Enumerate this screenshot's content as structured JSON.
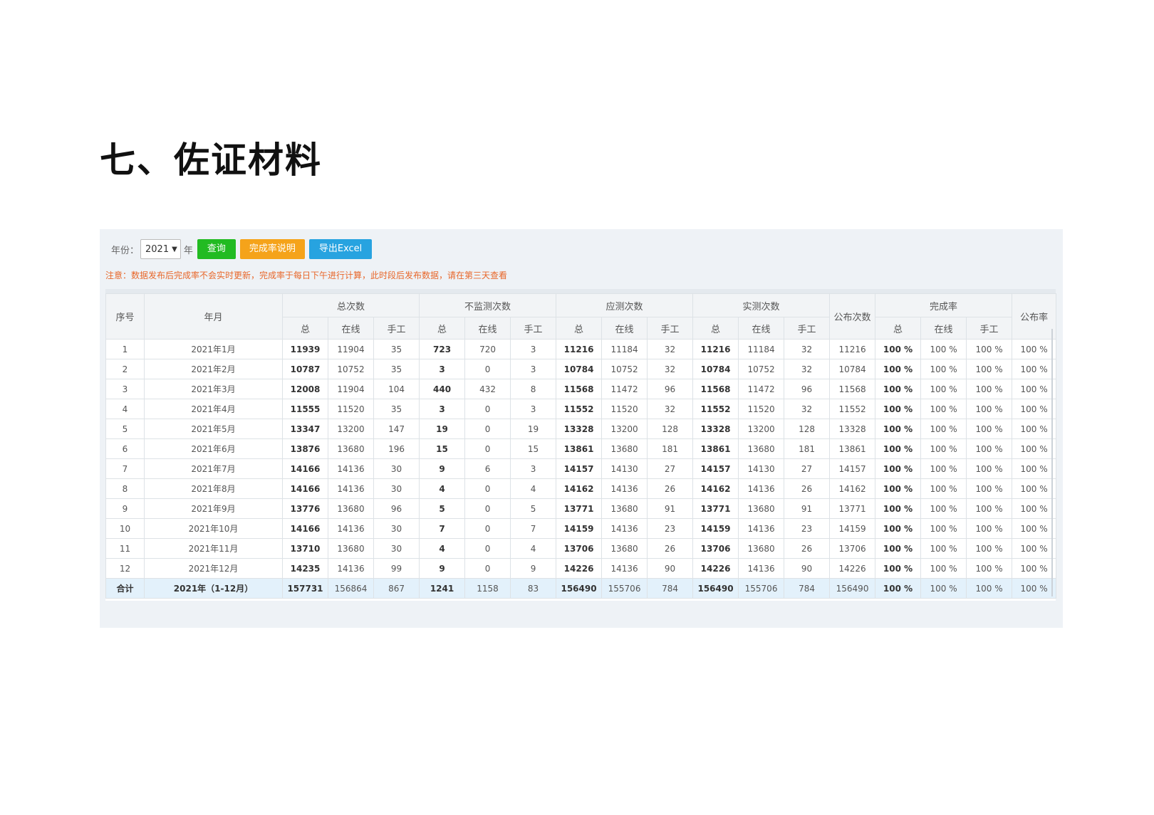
{
  "heading": "七、佐证材料",
  "toolbar": {
    "year_label": "年份：",
    "year_value": "2021",
    "year_unit": "年",
    "query_label": "查询",
    "rate_label": "完成率说明",
    "excel_label": "导出Excel"
  },
  "notice": "注意：数据发布后完成率不会实时更新，完成率于每日下午进行计算，此时段后发布数据，请在第三天查看",
  "table": {
    "groups": {
      "seq": "序号",
      "month": "年月",
      "total": "总次数",
      "nomon": "不监测次数",
      "should": "应测次数",
      "actual": "实测次数",
      "publish": "公布次数",
      "rate": "完成率",
      "prate": "公布率"
    },
    "sub": {
      "all": "总",
      "online": "在线",
      "manual": "手工"
    },
    "rows": [
      [
        "1",
        "2021年1月",
        "11939",
        "11904",
        "35",
        "723",
        "720",
        "3",
        "11216",
        "11184",
        "32",
        "11216",
        "11184",
        "32",
        "11216",
        "100 %",
        "100 %",
        "100 %",
        "100 %"
      ],
      [
        "2",
        "2021年2月",
        "10787",
        "10752",
        "35",
        "3",
        "0",
        "3",
        "10784",
        "10752",
        "32",
        "10784",
        "10752",
        "32",
        "10784",
        "100 %",
        "100 %",
        "100 %",
        "100 %"
      ],
      [
        "3",
        "2021年3月",
        "12008",
        "11904",
        "104",
        "440",
        "432",
        "8",
        "11568",
        "11472",
        "96",
        "11568",
        "11472",
        "96",
        "11568",
        "100 %",
        "100 %",
        "100 %",
        "100 %"
      ],
      [
        "4",
        "2021年4月",
        "11555",
        "11520",
        "35",
        "3",
        "0",
        "3",
        "11552",
        "11520",
        "32",
        "11552",
        "11520",
        "32",
        "11552",
        "100 %",
        "100 %",
        "100 %",
        "100 %"
      ],
      [
        "5",
        "2021年5月",
        "13347",
        "13200",
        "147",
        "19",
        "0",
        "19",
        "13328",
        "13200",
        "128",
        "13328",
        "13200",
        "128",
        "13328",
        "100 %",
        "100 %",
        "100 %",
        "100 %"
      ],
      [
        "6",
        "2021年6月",
        "13876",
        "13680",
        "196",
        "15",
        "0",
        "15",
        "13861",
        "13680",
        "181",
        "13861",
        "13680",
        "181",
        "13861",
        "100 %",
        "100 %",
        "100 %",
        "100 %"
      ],
      [
        "7",
        "2021年7月",
        "14166",
        "14136",
        "30",
        "9",
        "6",
        "3",
        "14157",
        "14130",
        "27",
        "14157",
        "14130",
        "27",
        "14157",
        "100 %",
        "100 %",
        "100 %",
        "100 %"
      ],
      [
        "8",
        "2021年8月",
        "14166",
        "14136",
        "30",
        "4",
        "0",
        "4",
        "14162",
        "14136",
        "26",
        "14162",
        "14136",
        "26",
        "14162",
        "100 %",
        "100 %",
        "100 %",
        "100 %"
      ],
      [
        "9",
        "2021年9月",
        "13776",
        "13680",
        "96",
        "5",
        "0",
        "5",
        "13771",
        "13680",
        "91",
        "13771",
        "13680",
        "91",
        "13771",
        "100 %",
        "100 %",
        "100 %",
        "100 %"
      ],
      [
        "10",
        "2021年10月",
        "14166",
        "14136",
        "30",
        "7",
        "0",
        "7",
        "14159",
        "14136",
        "23",
        "14159",
        "14136",
        "23",
        "14159",
        "100 %",
        "100 %",
        "100 %",
        "100 %"
      ],
      [
        "11",
        "2021年11月",
        "13710",
        "13680",
        "30",
        "4",
        "0",
        "4",
        "13706",
        "13680",
        "26",
        "13706",
        "13680",
        "26",
        "13706",
        "100 %",
        "100 %",
        "100 %",
        "100 %"
      ],
      [
        "12",
        "2021年12月",
        "14235",
        "14136",
        "99",
        "9",
        "0",
        "9",
        "14226",
        "14136",
        "90",
        "14226",
        "14136",
        "90",
        "14226",
        "100 %",
        "100 %",
        "100 %",
        "100 %"
      ]
    ],
    "total": [
      "合计",
      "2021年（1-12月）",
      "157731",
      "156864",
      "867",
      "1241",
      "1158",
      "83",
      "156490",
      "155706",
      "784",
      "156490",
      "155706",
      "784",
      "156490",
      "100 %",
      "100 %",
      "100 %",
      "100 %"
    ]
  }
}
